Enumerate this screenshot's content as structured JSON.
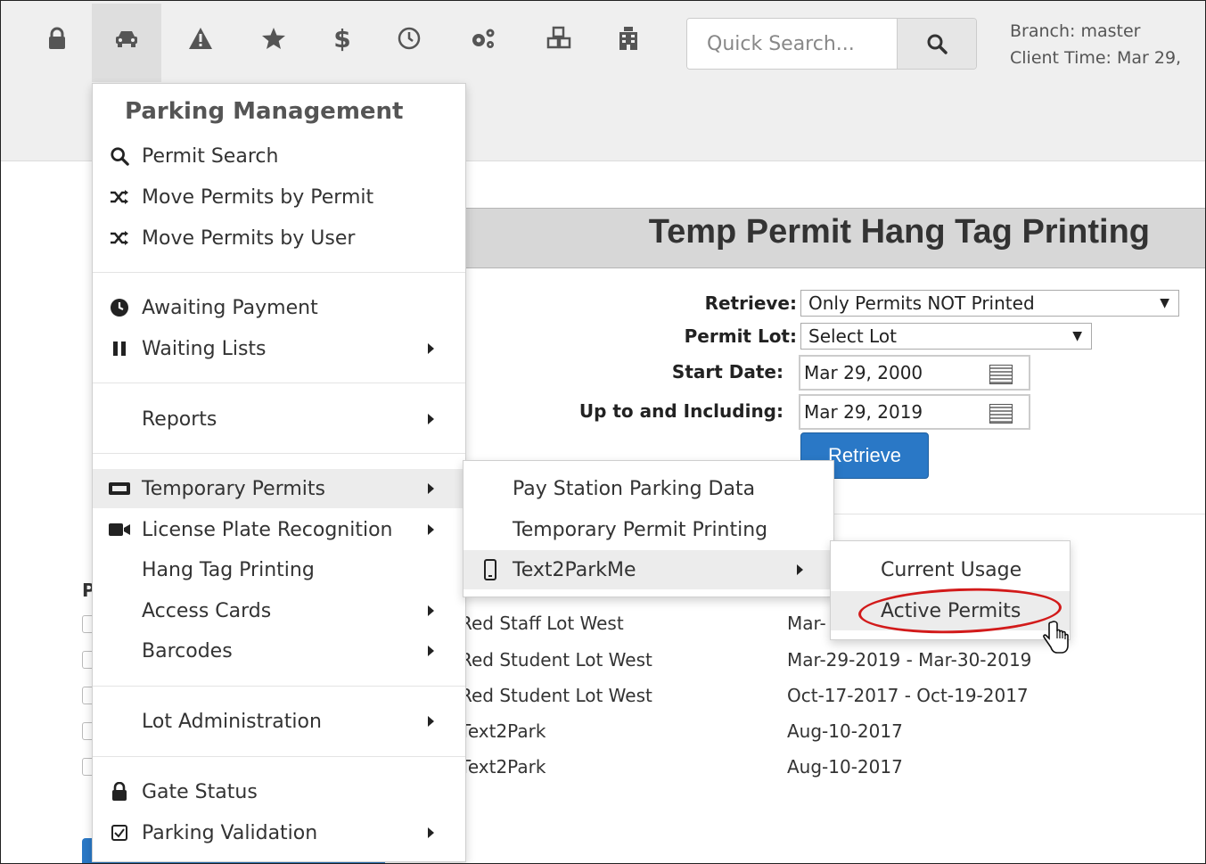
{
  "nav": {
    "icons": [
      "lock-icon",
      "car-icon",
      "warning-icon",
      "star-icon",
      "dollar-icon",
      "clock-icon",
      "gears-icon",
      "cubes-icon",
      "building-icon"
    ],
    "search_placeholder": "Quick Search...",
    "branch": "Branch: master",
    "client_time": "Client Time: Mar 29,"
  },
  "page": {
    "title": "Temp Permit Hang Tag Printing",
    "form": {
      "retrieve_label": "Retrieve:",
      "retrieve_value": "Only Permits NOT Printed",
      "lot_label": "Permit Lot:",
      "lot_value": "Select Lot",
      "start_label": "Start Date:",
      "start_value": "Mar 29, 2000",
      "upto_label": "Up to and Including:",
      "upto_value": "Mar 29, 2019",
      "retrieve_button": "Retrieve"
    },
    "left_header": "P",
    "rows": [
      {
        "lot": "Red Staff Lot West",
        "dates": "Mar-"
      },
      {
        "lot": "Red Student Lot West",
        "dates": "Mar-29-2019 - Mar-30-2019"
      },
      {
        "lot": "Red Student Lot West",
        "dates": "Oct-17-2017 - Oct-19-2017"
      },
      {
        "lot": "Text2Park",
        "dates": "Aug-10-2017"
      },
      {
        "lot": "Text2Park",
        "dates": "Aug-10-2017"
      }
    ]
  },
  "menu": {
    "header": "Parking Management",
    "items": [
      {
        "label": "Permit Search",
        "icon": "search-icon"
      },
      {
        "label": "Move Permits by Permit",
        "icon": "shuffle-icon"
      },
      {
        "label": "Move Permits by User",
        "icon": "shuffle-icon"
      },
      {
        "label": "Awaiting Payment",
        "icon": "clock-icon"
      },
      {
        "label": "Waiting Lists",
        "icon": "pause-icon"
      },
      {
        "label": "Reports",
        "icon": ""
      },
      {
        "label": "Temporary Permits",
        "icon": "ticket-icon"
      },
      {
        "label": "License Plate Recognition",
        "icon": "video-camera-icon"
      },
      {
        "label": "Hang Tag Printing",
        "icon": ""
      },
      {
        "label": "Access Cards",
        "icon": ""
      },
      {
        "label": "Barcodes",
        "icon": ""
      },
      {
        "label": "Lot Administration",
        "icon": ""
      },
      {
        "label": "Gate Status",
        "icon": "lock-icon"
      },
      {
        "label": "Parking Validation",
        "icon": "checkbox-icon"
      }
    ]
  },
  "submenu1": {
    "items": [
      {
        "label": "Pay Station Parking Data"
      },
      {
        "label": "Temporary Permit Printing"
      },
      {
        "label": "Text2ParkMe",
        "icon": "mobile-icon"
      }
    ]
  },
  "submenu2": {
    "items": [
      {
        "label": "Current Usage"
      },
      {
        "label": "Active Permits"
      }
    ]
  }
}
